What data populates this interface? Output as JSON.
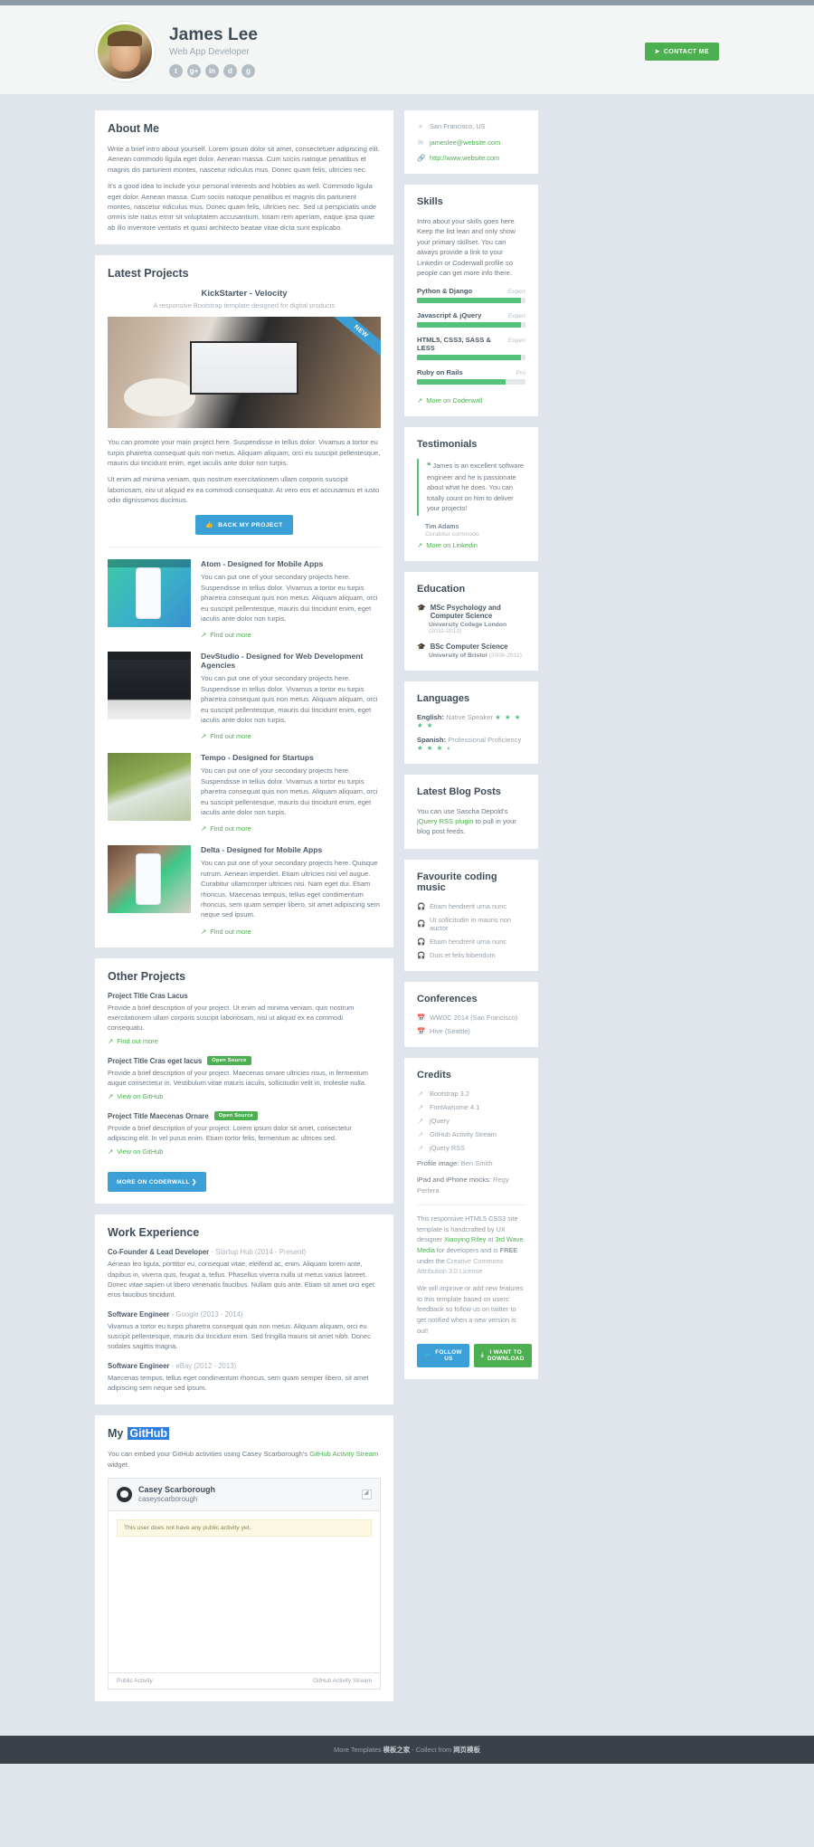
{
  "header": {
    "name": "James Lee",
    "tagline": "Web App Developer",
    "contact_button": "CONTACT ME",
    "socials": [
      {
        "name": "twitter-icon",
        "glyph": "t"
      },
      {
        "name": "google-plus-icon",
        "glyph": "g"
      },
      {
        "name": "linkedin-icon",
        "glyph": "in"
      },
      {
        "name": "dribbble-icon",
        "glyph": "d"
      },
      {
        "name": "github-icon",
        "glyph": "g"
      }
    ]
  },
  "about": {
    "title": "About Me",
    "p1": "Write a brief intro about yourself. Lorem ipsum dolor sit amet, consectetuer adipiscing elit. Aenean commodo ligula eget dolor. Aenean massa. Cum sociis natoque penatibus et magnis dis parturient montes, nascetur ridiculus mus. Donec quam felis, ultricies nec.",
    "p2": "It's a good idea to include your personal interests and hobbies as well. Commodo ligula eget dolor. Aenean massa. Cum sociis natoque penatibus et magnis dis parturient montes, nascetur ridiculus mus. Donec quam felis, ultricies nec. Sed ut perspiciatis unde omnis iste natus error sit voluptatem accusantium, totam rem aperiam, eaque ipsa quae ab illo inventore veritatis et quasi architecto beatae vitae dicta sunt explicabo."
  },
  "contact": {
    "location": "San Francisco, US",
    "email": "jameslee@website.com",
    "website": "http://www.website.com"
  },
  "skills": {
    "title": "Skills",
    "intro": "Intro about your skills goes here. Keep the list lean and only show your primary skillset. You can always provide a link to your Linkedin or Coderwall profile so people can get more info there.",
    "items": [
      {
        "name": "Python & Django",
        "level": "Expert",
        "pct": 96
      },
      {
        "name": "Javascript & jQuery",
        "level": "Expert",
        "pct": 96
      },
      {
        "name": "HTML5, CSS3, SASS & LESS",
        "level": "Expert",
        "pct": 96
      },
      {
        "name": "Ruby on Rails",
        "level": "Pro",
        "pct": 82
      }
    ],
    "more_link": "More on Coderwall"
  },
  "testimonials": {
    "title": "Testimonials",
    "quote": "James is an excellent software engineer and he is passionate about what he does. You can totally count on him to deliver your projects!",
    "author": "Tim Adams",
    "author_title": "Curabitur commodo",
    "more_link": "More on Linkedin"
  },
  "education": {
    "title": "Education",
    "items": [
      {
        "degree": "MSc Psychology and Computer Science",
        "school": "University College London",
        "years": "(2011-2012)"
      },
      {
        "degree": "BSc Computer Science",
        "school": "University of Bristol",
        "years": "(2008-2011)"
      }
    ]
  },
  "languages": {
    "title": "Languages",
    "items": [
      {
        "lang": "English:",
        "level": "Native Speaker",
        "stars": "★ ★ ★ ★ ★"
      },
      {
        "lang": "Spanish:",
        "level": "Professional Proficiency",
        "stars": "★ ★ ★ ◖"
      }
    ]
  },
  "blog": {
    "title": "Latest Blog Posts",
    "text_before": "You can use Sascha Depold's ",
    "link": "jQuery RSS plugin",
    "text_after": " to pull in your blog post feeds."
  },
  "music": {
    "title": "Favourite coding music",
    "items": [
      "Etiam hendrerit urna nunc",
      "Ut sollicitudin in mauris non auctor",
      "Etiam hendrerit urna nunc",
      "Duis et felis bibendum"
    ]
  },
  "conferences": {
    "title": "Conferences",
    "items": [
      "WWDC 2014 (San Francisco)",
      "Hive (Seattle)"
    ]
  },
  "credits": {
    "title": "Credits",
    "links": [
      "Bootstrap 3.2",
      "FontAwsome 4.1",
      "jQuery",
      "GitHub Activity Stream",
      "jQuery RSS"
    ],
    "profile_image_label": "Profile image",
    "profile_image_credit": "Ben Smith",
    "mocks_label": "iPad and iPhone mocks",
    "mocks_credit": "Regy Perlera",
    "note_1a": "This responsive HTML5 CSS3 site template is handcrafted by UX designer ",
    "note_1b": "Xiaoying Riley",
    "note_1c": " at ",
    "note_1d": "3rd Wave Media",
    "note_1e": " for developers and is ",
    "note_1f": "FREE",
    "note_1g": " under the ",
    "note_1h": "Creative Commons Attribution 3.0 License",
    "note_2": "We will improve or add new features to this template based on users' feedback so follow us on twitter to get notified when a new version is out!",
    "follow_button": "FOLLOW US",
    "download_button": "I WANT TO DOWNLOAD"
  },
  "latest_projects": {
    "title": "Latest Projects",
    "featured": {
      "name": "KickStarter - Velocity",
      "subtitle": "A responsive Bootstrap template designed for digital products",
      "ribbon": "NEW",
      "p1": "You can promote your main project here. Suspendisse in tellus dolor. Vivamus a tortor eu turpis pharetra consequat quis non metus. Aliquam aliquam, orci eu suscipit pellentesque, mauris dui tincidunt enim, eget iaculis ante dolor non turpis.",
      "p2": "Ut enim ad minima veniam, quis nostrum exercitationem ullam corporis suscipit laboriosam, nisi ut aliquid ex ea commodi consequatur. At vero eos et accusamus et iusto odio dignissimos ducimus.",
      "button": "BACK MY PROJECT"
    },
    "items": [
      {
        "title": "Atom - Designed for Mobile Apps",
        "desc": "You can put one of your secondary projects here. Suspendisse in tellus dolor. Vivamus a tortor eu turpis pharetra consequat quis non metus. Aliquam aliquam, orci eu suscipit pellentesque, mauris dui tincidunt enim, eget iaculis ante dolor non turpis.",
        "link": "Find out more"
      },
      {
        "title": "DevStudio - Designed for Web Development Agencies",
        "desc": "You can put one of your secondary projects here. Suspendisse in tellus dolor. Vivamus a tortor eu turpis pharetra consequat quis non metus. Aliquam aliquam, orci eu suscipit pellentesque, mauris dui tincidunt enim, eget iaculis ante dolor non turpis.",
        "link": "Find out more"
      },
      {
        "title": "Tempo - Designed for Startups",
        "desc": "You can put one of your secondary projects here. Suspendisse in tellus dolor. Vivamus a tortor eu turpis pharetra consequat quis non metus. Aliquam aliquam, orci eu suscipit pellentesque, mauris dui tincidunt enim, eget iaculis ante dolor non turpis.",
        "link": "Find out more"
      },
      {
        "title": "Delta - Designed for Mobile Apps",
        "desc": "You can put one of your secondary projects here. Quisque rutrum. Aenean imperdiet. Etiam ultricies nisi vel augue. Curabitur ullamcorper ultricies nisi. Nam eget dui. Etiam rhoncus. Maecenas tempus, tellus eget condimentum rhoncus, sem quam semper libero, sit amet adipiscing sem neque sed ipsum.",
        "link": "Find out more"
      }
    ]
  },
  "other_projects": {
    "title": "Other Projects",
    "items": [
      {
        "title": "Project Title Cras Lacus",
        "badge": "",
        "desc": "Provide a brief description of your project. Ut enim ad minima veniam, quis nostrum exercitationem ullam corporis suscipit laboriosam, nisi ut aliquid ex ea commodi consequatu.",
        "link": "Find out more"
      },
      {
        "title": "Project Title Cras eget lacus",
        "badge": "Open Source",
        "desc": "Provide a brief description of your project. Maecenas ornare ultricies risus, in fermentum augue consectetur in. Vestibulum vitae mauris iaculis, sollicitudin velit in, molestie nulla.",
        "link": "View on GitHub"
      },
      {
        "title": "Project Title Maecenas Ornare",
        "badge": "Open Source",
        "desc": "Provide a brief description of your project. Lorem ipsum dolor sit amet, consectetur adipiscing elit. In vel purus enim. Etiam tortor felis, fermentum ac ultrices sed.",
        "link": "View on GitHub"
      }
    ],
    "button": "MORE ON CODERWALL ❯"
  },
  "work": {
    "title": "Work Experience",
    "jobs": [
      {
        "role": "Co-Founder & Lead Developer",
        "meta": "- Startup Hub (2014 - Present)",
        "desc": "Aenean leo ligula, porttitor eu, consequat vitae, eleifend ac, enim. Aliquam lorem ante, dapibus in, viverra quis, feugiat a, tellus. Phasellus viverra nulla ut metus varius laoreet. Donec vitae sapien ut libero venenatis faucibus. Nullam quis ante. Etiam sit amet orci eget eros faucibus tincidunt."
      },
      {
        "role": "Software Engineer",
        "meta": "- Google (2013 - 2014)",
        "desc": "Vivamus a tortor eu turpis pharetra consequat quis non metus. Aliquam aliquam, orci eu suscipit pellentesque, mauris dui tincidunt enim. Sed fringilla mauris sit amet nibh. Donec sodales sagittis magna."
      },
      {
        "role": "Software Engineer",
        "meta": "- eBay (2012 - 2013)",
        "desc": "Maecenas tempus, tellus eget condimentum rhoncus, sem quam semper libero, sit amet adipiscing sem neque sed ipsum."
      }
    ]
  },
  "github": {
    "title_a": "My ",
    "title_b": "GitHub",
    "intro_before": "You can embed your GitHub activities using Casey Scarborough's ",
    "intro_link": "GitHub Activity Stream",
    "intro_after": " widget.",
    "user_name": "Casey Scarborough",
    "user_handle": "caseyscarborough",
    "alert": "This user does not have any public activity yet.",
    "foot_left": "Public Activity",
    "foot_right": "GitHub Activity Stream"
  },
  "footer": {
    "before": "More Templates ",
    "link1": "模板之家",
    "middle": " - Collect from ",
    "link2": "网页模板"
  }
}
